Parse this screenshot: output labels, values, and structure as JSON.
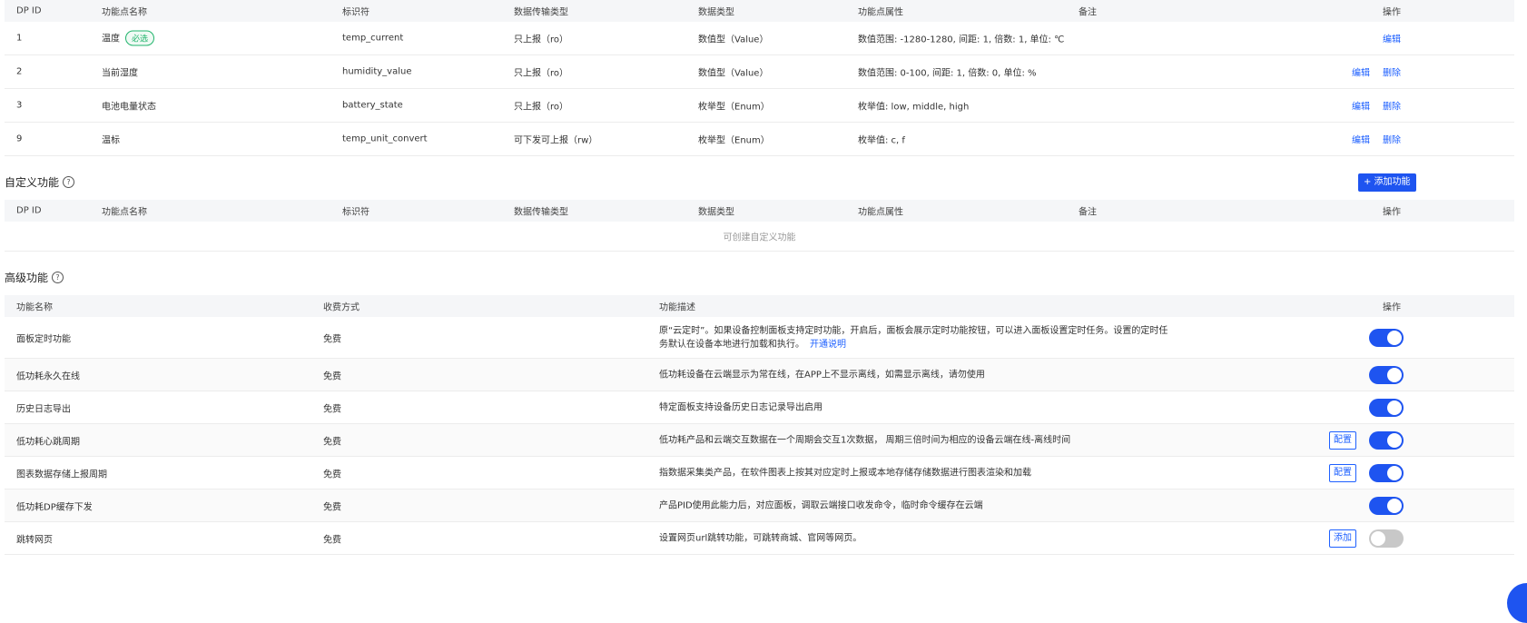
{
  "dp_table": {
    "headers": [
      "DP ID",
      "功能点名称",
      "标识符",
      "数据传输类型",
      "数据类型",
      "功能点属性",
      "备注",
      "操作"
    ],
    "rows": [
      {
        "id": "1",
        "name": "温度",
        "badge": "必选",
        "code": "temp_current",
        "transfer": "只上报（ro）",
        "type": "数值型（Value）",
        "props": "数值范围: -1280-1280, 间距: 1, 倍数: 1, 单位: ℃",
        "actions": [
          "编辑"
        ]
      },
      {
        "id": "2",
        "name": "当前湿度",
        "badge": "",
        "code": "humidity_value",
        "transfer": "只上报（ro）",
        "type": "数值型（Value）",
        "props": "数值范围: 0-100, 间距: 1, 倍数: 0, 单位: %",
        "actions": [
          "编辑",
          "删除"
        ]
      },
      {
        "id": "3",
        "name": "电池电量状态",
        "badge": "",
        "code": "battery_state",
        "transfer": "只上报（ro）",
        "type": "枚举型（Enum）",
        "props": "枚举值: low, middle, high",
        "actions": [
          "编辑",
          "删除"
        ]
      },
      {
        "id": "9",
        "name": "温标",
        "badge": "",
        "code": "temp_unit_convert",
        "transfer": "可下发可上报（rw）",
        "type": "枚举型（Enum）",
        "props": "枚举值: c, f",
        "actions": [
          "编辑",
          "删除"
        ]
      }
    ]
  },
  "custom": {
    "title": "自定义功能",
    "add_label": "+ 添加功能",
    "headers": [
      "DP ID",
      "功能点名称",
      "标识符",
      "数据传输类型",
      "数据类型",
      "功能点属性",
      "备注",
      "操作"
    ],
    "empty_text": "可创建自定义功能"
  },
  "advanced": {
    "title": "高级功能",
    "headers": [
      "功能名称",
      "收费方式",
      "功能描述",
      "操作"
    ],
    "rows": [
      {
        "name": "面板定时功能",
        "fee": "免费",
        "desc": "原“云定时”。如果设备控制面板支持定时功能，开启后，面板会展示定时功能按钮，可以进入面板设置定时任务。设置的定时任",
        "desc2": "务默认在设备本地进行加载和执行。",
        "link": "开通说明",
        "button": "",
        "enabled": true
      },
      {
        "name": "低功耗永久在线",
        "fee": "免费",
        "desc": "低功耗设备在云端显示为常在线，在APP上不显示离线，如需显示离线，请勿使用",
        "desc2": "",
        "link": "",
        "button": "",
        "enabled": true
      },
      {
        "name": "历史日志导出",
        "fee": "免费",
        "desc": "特定面板支持设备历史日志记录导出启用",
        "desc2": "",
        "link": "",
        "button": "",
        "enabled": true
      },
      {
        "name": "低功耗心跳周期",
        "fee": "免费",
        "desc": "低功耗产品和云端交互数据在一个周期会交互1次数据， 周期三倍时间为相应的设备云端在线-离线时间",
        "desc2": "",
        "link": "",
        "button": "配置",
        "enabled": true
      },
      {
        "name": "图表数据存储上报周期",
        "fee": "免费",
        "desc": "指数据采集类产品，在软件图表上按其对应定时上报或本地存储存储数据进行图表渲染和加载",
        "desc2": "",
        "link": "",
        "button": "配置",
        "enabled": true
      },
      {
        "name": "低功耗DP缓存下发",
        "fee": "免费",
        "desc": "产品PID使用此能力后，对应面板，调取云端接口收发命令，临时命令缓存在云端",
        "desc2": "",
        "link": "",
        "button": "",
        "enabled": true
      },
      {
        "name": "跳转网页",
        "fee": "免费",
        "desc": "设置网页url跳转功能，可跳转商城、官网等网页。",
        "desc2": "",
        "link": "",
        "button": "添加",
        "enabled": false
      }
    ]
  }
}
